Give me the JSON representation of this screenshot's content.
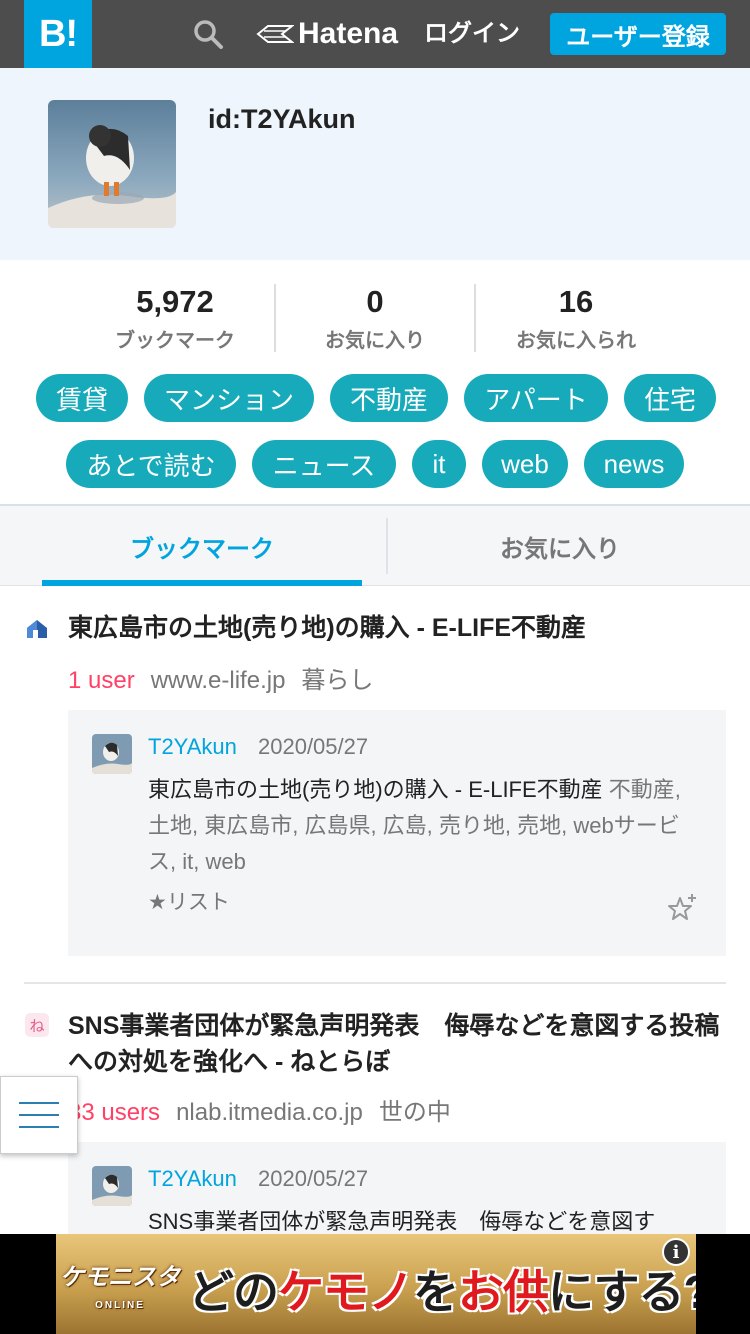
{
  "header": {
    "logo_text": "B!",
    "brand": "Hatena",
    "login": "ログイン",
    "register": "ユーザー登録"
  },
  "profile": {
    "id": "id:T2YAkun"
  },
  "stats": [
    {
      "value": "5,972",
      "label": "ブックマーク"
    },
    {
      "value": "0",
      "label": "お気に入り"
    },
    {
      "value": "16",
      "label": "お気に入られ"
    }
  ],
  "tags": [
    "賃貸",
    "マンション",
    "不動産",
    "アパート",
    "住宅",
    "あとで読む",
    "ニュース",
    "it",
    "web",
    "news"
  ],
  "tabs": {
    "bookmark": "ブックマーク",
    "favorites": "お気に入り"
  },
  "entries": [
    {
      "title": "東広島市の土地(売り地)の購入 - E-LIFE不動産",
      "users": "1 user",
      "domain": "www.e-life.jp",
      "category": "暮らし",
      "comment": {
        "user": "T2YAkun",
        "date": "2020/05/27",
        "text": "東広島市の土地(売り地)の購入 - E-LIFE不動産",
        "tags": "不動産, 土地, 東広島市, 広島県, 広島, 売り地, 売地, webサービス, it, web",
        "list": "★リスト"
      }
    },
    {
      "title": "SNS事業者団体が緊急声明発表　侮辱などを意図する投稿への対処を強化へ - ねとらぼ",
      "users": "33 users",
      "domain": "nlab.itmedia.co.jp",
      "category": "世の中",
      "comment": {
        "user": "T2YAkun",
        "date": "2020/05/27",
        "text": "SNS事業者団体が緊急声明発表　侮辱などを意図す"
      }
    }
  ],
  "ad": {
    "game": "ケモニスタ",
    "game_sub": "ONLINE",
    "text_1": "どの",
    "text_2": "ケモノ",
    "text_3": "を",
    "text_4": "お供",
    "text_5": "にする?",
    "info": "i"
  },
  "colors": {
    "accent": "#00a4de",
    "tag": "#16aabb",
    "users": "#ff4166",
    "header": "#4d4d4d"
  }
}
